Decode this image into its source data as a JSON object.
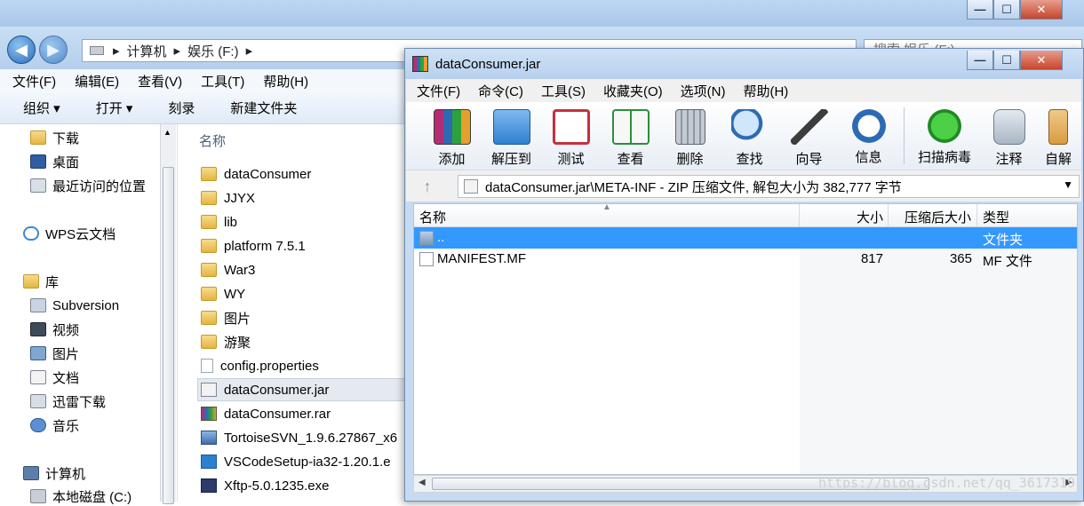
{
  "explorer": {
    "address_parts": [
      "计算机",
      "娱乐 (F:)"
    ],
    "search_placeholder": "搜索 娱乐 (F:)",
    "menu": [
      "文件(F)",
      "编辑(E)",
      "查看(V)",
      "工具(T)",
      "帮助(H)"
    ],
    "toolbar": [
      "组织 ▾",
      "打开 ▾",
      "刻录",
      "新建文件夹"
    ],
    "nav": {
      "favorites": [
        "下载",
        "桌面",
        "最近访问的位置"
      ],
      "cloud": "WPS云文档",
      "library": "库",
      "library_items": [
        "Subversion",
        "视频",
        "图片",
        "文档",
        "迅雷下载",
        "音乐"
      ],
      "computer": "计算机",
      "computer_items": [
        "本地磁盘 (C:)"
      ]
    },
    "list_header": "名称",
    "files": [
      {
        "name": "dataConsumer",
        "kind": "folder"
      },
      {
        "name": "JJYX",
        "kind": "folder"
      },
      {
        "name": "lib",
        "kind": "folder"
      },
      {
        "name": "platform 7.5.1",
        "kind": "folder"
      },
      {
        "name": "War3",
        "kind": "folder"
      },
      {
        "name": "WY",
        "kind": "folder"
      },
      {
        "name": "图片",
        "kind": "folder"
      },
      {
        "name": "游聚",
        "kind": "folder"
      },
      {
        "name": "config.properties",
        "kind": "doc"
      },
      {
        "name": "dataConsumer.jar",
        "kind": "jar"
      },
      {
        "name": "dataConsumer.rar",
        "kind": "rar"
      },
      {
        "name": "TortoiseSVN_1.9.6.27867_x6",
        "kind": "svn"
      },
      {
        "name": "VSCodeSetup-ia32-1.20.1.e",
        "kind": "vs"
      },
      {
        "name": "Xftp-5.0.1235.exe",
        "kind": "xftp"
      }
    ]
  },
  "rar": {
    "title": "dataConsumer.jar",
    "menu": [
      "文件(F)",
      "命令(C)",
      "工具(S)",
      "收藏夹(O)",
      "选项(N)",
      "帮助(H)"
    ],
    "toolbar": [
      "添加",
      "解压到",
      "测试",
      "查看",
      "删除",
      "查找",
      "向导",
      "信息",
      "扫描病毒",
      "注释",
      "自解"
    ],
    "path": "dataConsumer.jar\\META-INF - ZIP 压缩文件, 解包大小为 382,777 字节",
    "columns": [
      "名称",
      "大小",
      "压缩后大小",
      "类型"
    ],
    "rows": [
      {
        "name": "..",
        "size": "",
        "packed": "",
        "type": "文件夹",
        "selected": true
      },
      {
        "name": "MANIFEST.MF",
        "size": "817",
        "packed": "365",
        "type": "MF 文件",
        "selected": false
      }
    ],
    "icon_names": [
      "add-icon",
      "extract-icon",
      "test-icon",
      "view-icon",
      "delete-icon",
      "find-icon",
      "wizard-icon",
      "info-icon",
      "virus-scan-icon",
      "comment-icon",
      "sfx-icon"
    ]
  },
  "watermark": "https://blog.csdn.net/qq_3617319"
}
